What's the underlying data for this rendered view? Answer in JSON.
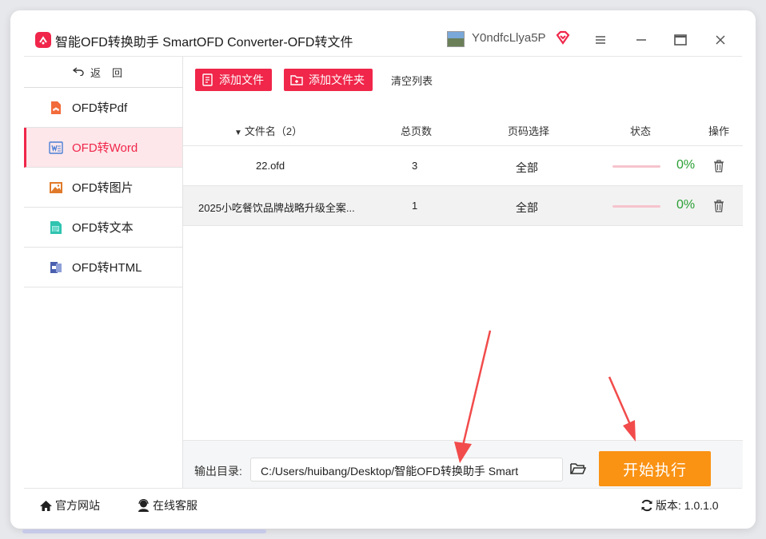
{
  "titlebar": {
    "app_title": "智能OFD转换助手 SmartOFD Converter-OFD转文件",
    "user_name": "Y0ndfcLlya5P",
    "menu_icon": "menu-icon",
    "min_icon": "minimize-icon",
    "max_icon": "maximize-icon",
    "close_icon": "close-icon"
  },
  "sidebar": {
    "back_label": "返回",
    "items": [
      {
        "label": "OFD转Pdf",
        "icon": "pdf-icon",
        "color": "#f26b3a"
      },
      {
        "label": "OFD转Word",
        "icon": "word-icon",
        "color": "#4a7fd6"
      },
      {
        "label": "OFD转图片",
        "icon": "image-icon",
        "color": "#e07a2a"
      },
      {
        "label": "OFD转文本",
        "icon": "text-icon",
        "color": "#2fc4b0"
      },
      {
        "label": "OFD转HTML",
        "icon": "html-icon",
        "color": "#4a5fae"
      }
    ]
  },
  "toolbar": {
    "add_file": "添加文件",
    "add_folder": "添加文件夹",
    "clear_list": "清空列表"
  },
  "table": {
    "headers": {
      "filename": "文件名（2）",
      "pages": "总页数",
      "page_select": "页码选择",
      "status": "状态",
      "action": "操作"
    },
    "rows": [
      {
        "filename": "22.ofd",
        "pages": "3",
        "page_select": "全部",
        "progress": "0%"
      },
      {
        "filename": "2025小吃餐饮品牌战略升级全案...",
        "pages": "1",
        "page_select": "全部",
        "progress": "0%"
      }
    ]
  },
  "output": {
    "label": "输出目录:",
    "path": "C:/Users/huibang/Desktop/智能OFD转换助手 Smart",
    "start_button": "开始执行"
  },
  "statusbar": {
    "website": "官方网站",
    "support": "在线客服",
    "version": "版本: 1.0.1.0"
  },
  "colors": {
    "accent": "#f0264a",
    "start": "#fa9213",
    "progress_text": "#2aa034"
  }
}
